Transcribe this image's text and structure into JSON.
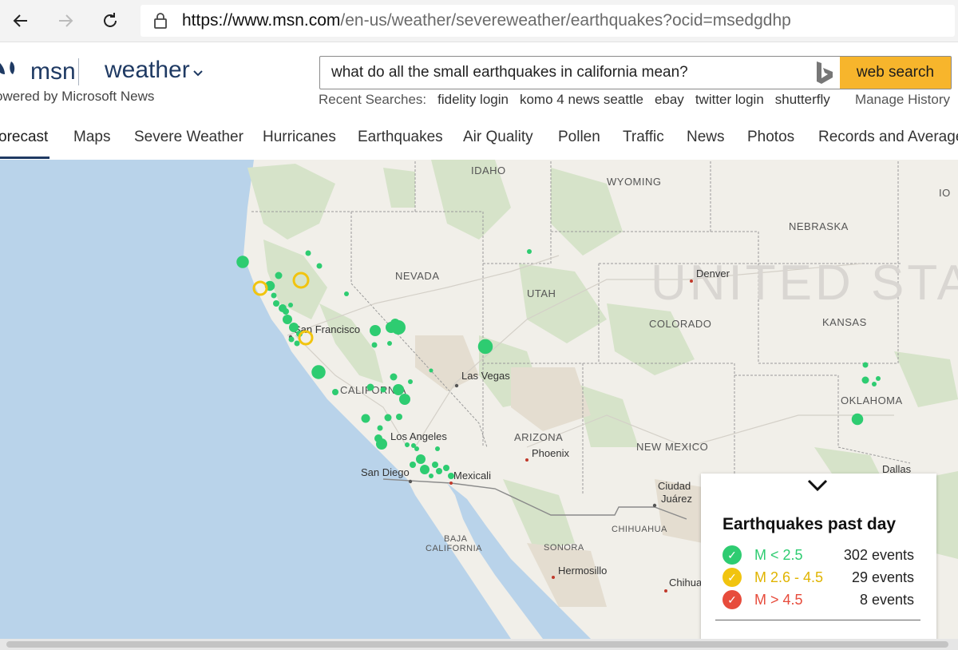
{
  "browser": {
    "url_host": "https://www.msn.com",
    "url_path": "/en-us/weather/severeweather/earthquakes?ocid=msedgdhp",
    "back_icon": "arrow-left-icon",
    "forward_icon": "arrow-right-icon",
    "refresh_icon": "refresh-icon",
    "lock_icon": "lock-icon"
  },
  "header": {
    "brand": "msn",
    "section": "weather",
    "powered_by": "owered by Microsoft News",
    "search_value": "what do all the small earthquakes in california mean?",
    "search_button": "web search",
    "recent_label": "Recent Searches:",
    "recent_items": [
      "fidelity login",
      "komo 4 news seattle",
      "ebay",
      "twitter login",
      "shutterfly"
    ],
    "manage_history": "Manage History",
    "accent_color": "#f7b52c",
    "brand_color": "#1f3a63"
  },
  "tabs": [
    "orecast",
    "Maps",
    "Severe Weather",
    "Hurricanes",
    "Earthquakes",
    "Air Quality",
    "Pollen",
    "Traffic",
    "News",
    "Photos",
    "Records and Average"
  ],
  "map": {
    "states": {
      "idaho": "IDAHO",
      "wyoming": "WYOMING",
      "nebraska": "NEBRASKA",
      "nevada": "NEVADA",
      "utah": "UTAH",
      "colorado": "COLORADO",
      "kansas": "KANSAS",
      "california": "CALIFORNIA",
      "arizona": "ARIZONA",
      "new_mexico": "NEW MEXICO",
      "oklahoma": "OKLAHOMA",
      "chihuahua": "CHIHUAHUA",
      "sonora": "SONORA",
      "baja_line1": "BAJA",
      "baja_line2": "CALIFORNIA",
      "io_fragment": "IO"
    },
    "country": "UNITED STA",
    "cities": {
      "denver": "Denver",
      "san_francisco": "San Francisco",
      "las_vegas": "Las Vegas",
      "los_angeles": "Los Angeles",
      "phoenix": "Phoenix",
      "san_diego": "San Diego",
      "mexicali": "Mexicali",
      "ciudad_line1": "Ciudad",
      "ciudad_line2": "Juárez",
      "hermosillo": "Hermosillo",
      "chihuahua_city": "Chihua",
      "dallas": "Dallas"
    }
  },
  "legend": {
    "collapse_icon": "chevron-down-icon",
    "title": "Earthquakes past day",
    "rows": [
      {
        "range": "M < 2.5",
        "count": "302 events",
        "color": "#2ecc71"
      },
      {
        "range": "M 2.6 - 4.5",
        "count": "29 events",
        "color": "#f1c40f"
      },
      {
        "range": "M > 4.5",
        "count": "8 events",
        "color": "#e74c3c"
      }
    ]
  }
}
